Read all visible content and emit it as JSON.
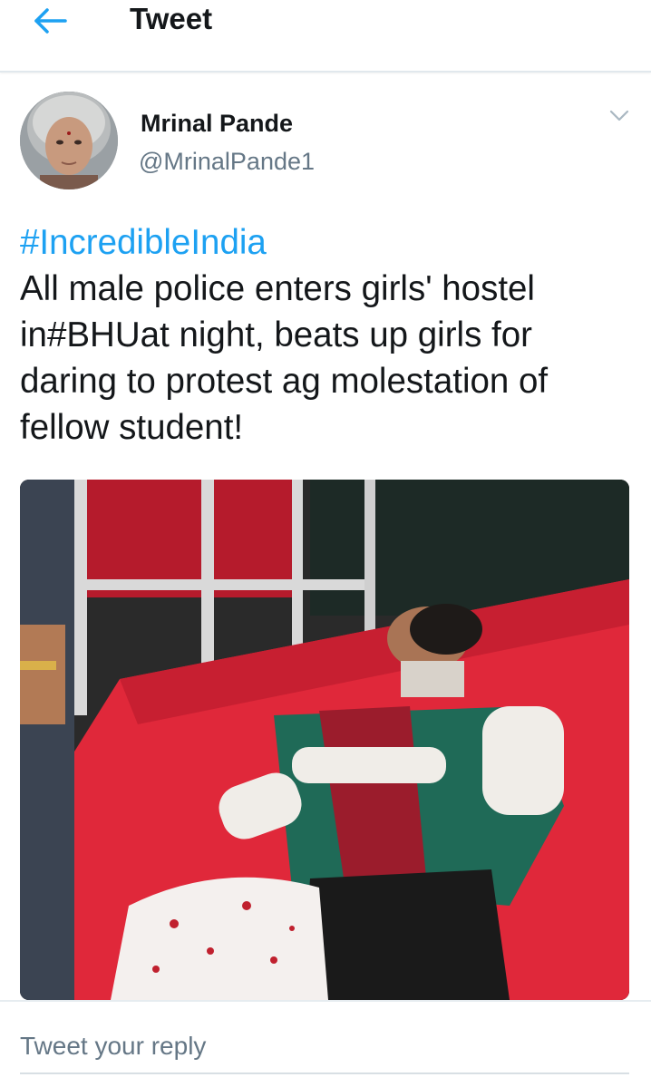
{
  "header": {
    "title": "Tweet",
    "back_icon": "arrow-left-icon",
    "accent_color": "#1da1f2"
  },
  "tweet": {
    "author": {
      "name": "Mrinal Pande",
      "handle": "@MrinalPande1"
    },
    "menu_icon": "chevron-down-icon",
    "hashtag": "#IncredibleIndia",
    "text": "All male police enters girls' hostel in#BHUat night, beats up girls for daring to protest ag molestation of fellow student!",
    "media_alt": "photo"
  },
  "reply": {
    "placeholder": "Tweet your reply"
  }
}
